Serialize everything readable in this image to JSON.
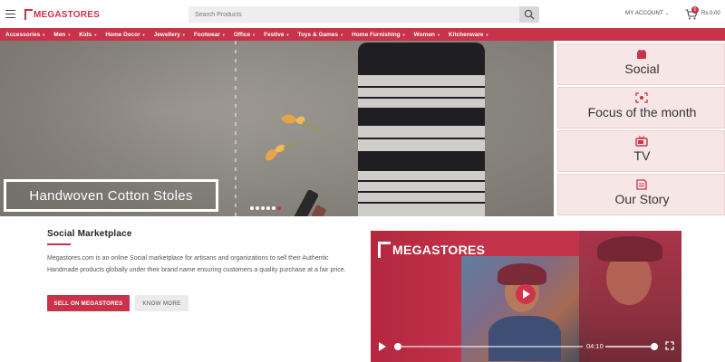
{
  "header": {
    "logo_text": "MEGASTORES",
    "search_placeholder": "Search Products",
    "account_label": "MY ACCOUNT",
    "cart_count": "0",
    "cart_total": "Rs.0.00"
  },
  "nav": {
    "items": [
      {
        "label": "Accessories"
      },
      {
        "label": "Men"
      },
      {
        "label": "Kids"
      },
      {
        "label": "Home Decor"
      },
      {
        "label": "Jewellery"
      },
      {
        "label": "Footwear"
      },
      {
        "label": "Office"
      },
      {
        "label": "Festive"
      },
      {
        "label": "Toys & Games"
      },
      {
        "label": "Home Furnishing"
      },
      {
        "label": "Women"
      },
      {
        "label": "Kitchenware"
      }
    ]
  },
  "hero": {
    "caption": "Handwoven Cotton Stoles",
    "slide_count": 7,
    "active_slide": 6
  },
  "side_cards": [
    {
      "label": "Social",
      "icon": "social-icon"
    },
    {
      "label": "Focus of the month",
      "icon": "focus-icon"
    },
    {
      "label": "TV",
      "icon": "tv-icon"
    },
    {
      "label": "Our Story",
      "icon": "story-icon"
    }
  ],
  "social_marketplace": {
    "title": "Social Marketplace",
    "description": "Megastores.com is an online Social marketplace for artisans and organizations to sell their Authentic Handmade products globally under their brand name ensuring customers a quality purchase at a fair price.",
    "primary_button": "SELL ON MEGASTORES",
    "secondary_button": "KNOW MORE"
  },
  "video": {
    "logo_text": "MEGASTORES",
    "time": "04:10",
    "progress": 0.0,
    "volume": 1.0
  },
  "colors": {
    "brand": "#c8334a",
    "card_bg": "#f7e6e6"
  }
}
